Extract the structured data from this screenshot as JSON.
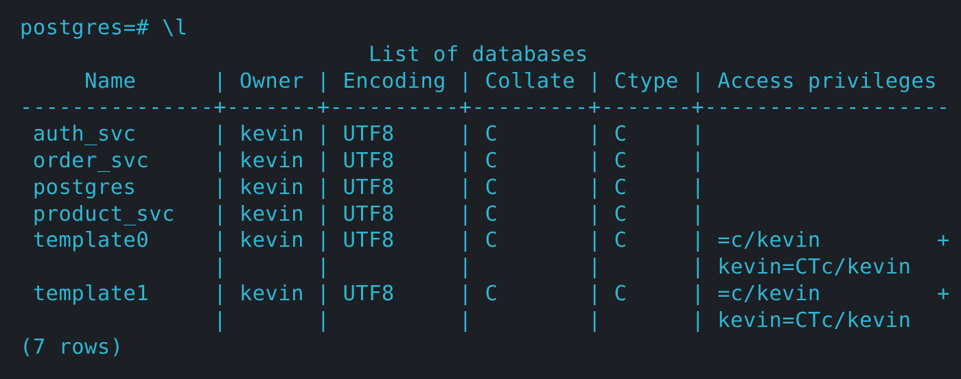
{
  "terminal": {
    "prompt": "postgres=#",
    "command": "\\l",
    "table_title": "List of databases",
    "columns": [
      "Name",
      "Owner",
      "Encoding",
      "Collate",
      "Ctype",
      "Access privileges"
    ],
    "rows": [
      {
        "name": "auth_svc",
        "owner": "kevin",
        "encoding": "UTF8",
        "collate": "C",
        "ctype": "C",
        "access": []
      },
      {
        "name": "order_svc",
        "owner": "kevin",
        "encoding": "UTF8",
        "collate": "C",
        "ctype": "C",
        "access": []
      },
      {
        "name": "postgres",
        "owner": "kevin",
        "encoding": "UTF8",
        "collate": "C",
        "ctype": "C",
        "access": []
      },
      {
        "name": "product_svc",
        "owner": "kevin",
        "encoding": "UTF8",
        "collate": "C",
        "ctype": "C",
        "access": []
      },
      {
        "name": "template0",
        "owner": "kevin",
        "encoding": "UTF8",
        "collate": "C",
        "ctype": "C",
        "access": [
          "=c/kevin",
          "kevin=CTc/kevin"
        ]
      },
      {
        "name": "template1",
        "owner": "kevin",
        "encoding": "UTF8",
        "collate": "C",
        "ctype": "C",
        "access": [
          "=c/kevin",
          "kevin=CTc/kevin"
        ]
      }
    ],
    "footer": "(7 rows)",
    "colors": {
      "background": "#1c1f24",
      "text": "#2fb6d3"
    }
  }
}
